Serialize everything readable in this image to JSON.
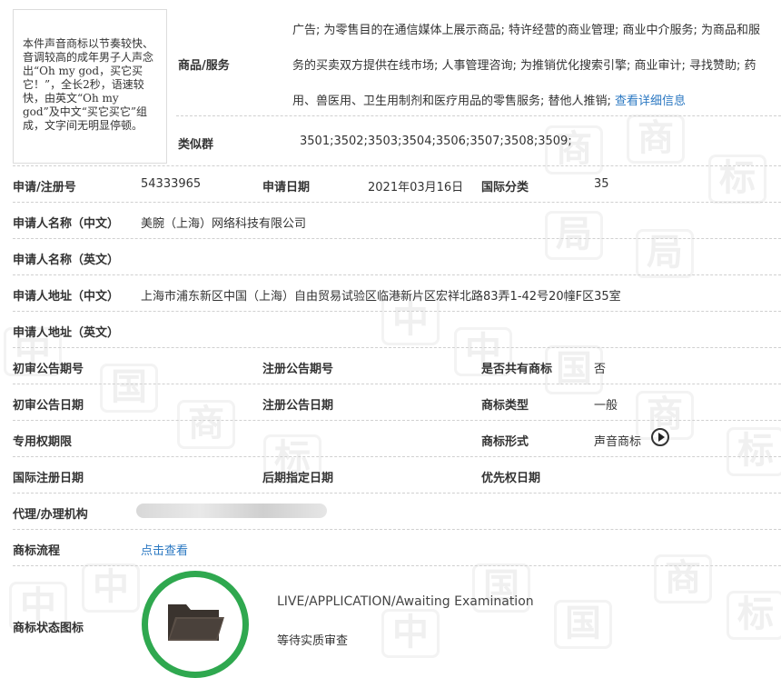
{
  "description_box": {
    "text": "本件声音商标以节奏较快、音调较高的成年男子人声念出“Oh my god，买它买它！”，全长2秒，语速较快，由英文“Oh my god”及中文“买它买它”组成，文字间无明显停顿。"
  },
  "goods": {
    "label": "商品/服务",
    "text": "广告; 为零售目的在通信媒体上展示商品; 特许经营的商业管理; 商业中介服务; 为商品和服务的买卖双方提供在线市场; 人事管理咨询; 为推销优化搜索引擎; 商业审计; 寻找赞助; 药用、兽医用、卫生用制剂和医疗用品的零售服务; 替他人推销;",
    "more_link": "查看详细信息"
  },
  "similar_group": {
    "label": "类似群",
    "value": "3501;3502;3503;3504;3506;3507;3508;3509;"
  },
  "reg_no": {
    "label": "申请/注册号",
    "value": "54333965"
  },
  "app_date": {
    "label": "申请日期",
    "value": "2021年03月16日"
  },
  "intl_class": {
    "label": "国际分类",
    "value": "35"
  },
  "applicant_cn": {
    "label": "申请人名称（中文）",
    "value": "美腕（上海）网络科技有限公司"
  },
  "applicant_en": {
    "label": "申请人名称（英文）",
    "value": ""
  },
  "address_cn": {
    "label": "申请人地址（中文）",
    "value": "上海市浦东新区中国（上海）自由贸易试验区临港新片区宏祥北路83弄1-42号20幢F区35室"
  },
  "address_en": {
    "label": "申请人地址（英文）",
    "value": ""
  },
  "prelim_no": {
    "label": "初审公告期号",
    "value": ""
  },
  "reg_pub_no": {
    "label": "注册公告期号",
    "value": ""
  },
  "shared_mark": {
    "label": "是否共有商标",
    "value": "否"
  },
  "prelim_date": {
    "label": "初审公告日期",
    "value": ""
  },
  "reg_pub_date": {
    "label": "注册公告日期",
    "value": ""
  },
  "mark_type": {
    "label": "商标类型",
    "value": "一般"
  },
  "exclusive_period": {
    "label": "专用权期限",
    "value": ""
  },
  "mark_form": {
    "label": "商标形式",
    "value": "声音商标"
  },
  "intl_reg_date": {
    "label": "国际注册日期",
    "value": ""
  },
  "later_date": {
    "label": "后期指定日期",
    "value": ""
  },
  "priority_date": {
    "label": "优先权日期",
    "value": ""
  },
  "agent": {
    "label": "代理/办理机构"
  },
  "process": {
    "label": "商标流程",
    "link": "点击查看"
  },
  "status": {
    "label": "商标状态图标",
    "en": "LIVE/APPLICATION/Awaiting Examination",
    "cn": "等待实质审查",
    "ring_color": "#2fa84f"
  }
}
